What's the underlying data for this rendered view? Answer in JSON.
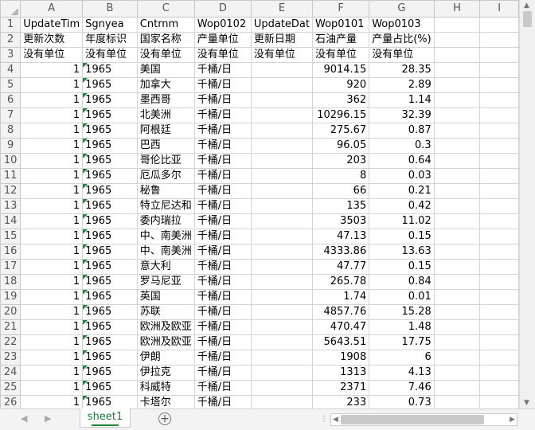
{
  "columns": [
    "A",
    "B",
    "C",
    "D",
    "E",
    "F",
    "G",
    "H",
    "I"
  ],
  "row_numbers": [
    "1",
    "2",
    "3",
    "4",
    "5",
    "6",
    "7",
    "8",
    "9",
    "10",
    "11",
    "12",
    "13",
    "14",
    "15",
    "16",
    "17",
    "18",
    "19",
    "20",
    "21",
    "22",
    "23",
    "24",
    "25",
    "26"
  ],
  "header_rows": [
    [
      "UpdateTim",
      "Sgnyea",
      "Cntrnm",
      "Wop0102",
      "UpdateDat",
      "Wop0101",
      "Wop0103",
      "",
      ""
    ],
    [
      "更新次数",
      "年度标识",
      "国家名称",
      "产量单位",
      "更新日期",
      "石油产量",
      "产量占比(%)",
      "",
      ""
    ],
    [
      "没有单位",
      "没有单位",
      "没有单位",
      "没有单位",
      "没有单位",
      "没有单位",
      "没有单位",
      "",
      ""
    ]
  ],
  "data_rows": [
    [
      "1",
      "1965",
      "美国",
      "千桶/日",
      "",
      "9014.15",
      "28.35"
    ],
    [
      "1",
      "1965",
      "加拿大",
      "千桶/日",
      "",
      "920",
      "2.89"
    ],
    [
      "1",
      "1965",
      "墨西哥",
      "千桶/日",
      "",
      "362",
      "1.14"
    ],
    [
      "1",
      "1965",
      "北美洲",
      "千桶/日",
      "",
      "10296.15",
      "32.39"
    ],
    [
      "1",
      "1965",
      "阿根廷",
      "千桶/日",
      "",
      "275.67",
      "0.87"
    ],
    [
      "1",
      "1965",
      "巴西",
      "千桶/日",
      "",
      "96.05",
      "0.3"
    ],
    [
      "1",
      "1965",
      "哥伦比亚",
      "千桶/日",
      "",
      "203",
      "0.64"
    ],
    [
      "1",
      "1965",
      "厄瓜多尔",
      "千桶/日",
      "",
      "8",
      "0.03"
    ],
    [
      "1",
      "1965",
      "秘鲁",
      "千桶/日",
      "",
      "66",
      "0.21"
    ],
    [
      "1",
      "1965",
      "特立尼达和",
      "千桶/日",
      "",
      "135",
      "0.42"
    ],
    [
      "1",
      "1965",
      "委内瑞拉",
      "千桶/日",
      "",
      "3503",
      "11.02"
    ],
    [
      "1",
      "1965",
      "中、南美洲",
      "千桶/日",
      "",
      "47.13",
      "0.15"
    ],
    [
      "1",
      "1965",
      "中、南美洲",
      "千桶/日",
      "",
      "4333.86",
      "13.63"
    ],
    [
      "1",
      "1965",
      "意大利",
      "千桶/日",
      "",
      "47.77",
      "0.15"
    ],
    [
      "1",
      "1965",
      "罗马尼亚",
      "千桶/日",
      "",
      "265.78",
      "0.84"
    ],
    [
      "1",
      "1965",
      "英国",
      "千桶/日",
      "",
      "1.74",
      "0.01"
    ],
    [
      "1",
      "1965",
      "苏联",
      "千桶/日",
      "",
      "4857.76",
      "15.28"
    ],
    [
      "1",
      "1965",
      "欧洲及欧亚",
      "千桶/日",
      "",
      "470.47",
      "1.48"
    ],
    [
      "1",
      "1965",
      "欧洲及欧亚",
      "千桶/日",
      "",
      "5643.51",
      "17.75"
    ],
    [
      "1",
      "1965",
      "伊朗",
      "千桶/日",
      "",
      "1908",
      "6"
    ],
    [
      "1",
      "1965",
      "伊拉克",
      "千桶/日",
      "",
      "1313",
      "4.13"
    ],
    [
      "1",
      "1965",
      "科威特",
      "千桶/日",
      "",
      "2371",
      "7.46"
    ],
    [
      "1",
      "1965",
      "卡塔尔",
      "千桶/日",
      "",
      "233",
      "0.73"
    ]
  ],
  "sheet_tab": "sheet1",
  "add_sheet_symbol": "+",
  "scroll_up": "▲",
  "scroll_down": "▼",
  "nav_prev": "◀",
  "nav_next": "▶"
}
